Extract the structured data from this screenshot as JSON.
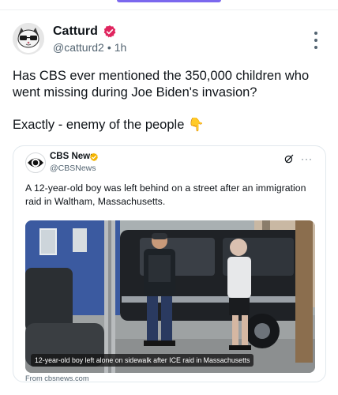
{
  "post": {
    "author_name": "Catturd",
    "handle": "@catturd2",
    "time": "1h",
    "text_line1": "Has CBS ever mentioned the 350,000 children who",
    "text_line2": "went missing during Joe Biden's invasion?",
    "text_line3": "Exactly - enemy of the people",
    "emoji": "👇",
    "verified_color": "#e0245e"
  },
  "quote": {
    "author_name": "CBS News",
    "handle": "@CBSNews",
    "verified_color": "#f4b400",
    "text": "A 12-year-old boy was left behind on a street after an immigration raid in Waltham, Massachusetts.",
    "media_caption": "12-year-old boy left alone on sidewalk after ICE raid in Massachusetts",
    "source": "From cbsnews.com"
  },
  "icons": {
    "more": "more-vertical-icon",
    "verified": "verified-badge-icon",
    "grok": "grok-icon",
    "quote_more": "more-horizontal-icon"
  },
  "colors": {
    "accent": "#7b68ee",
    "text": "#0f1419",
    "muted": "#536471",
    "border": "#e1e8ed"
  }
}
